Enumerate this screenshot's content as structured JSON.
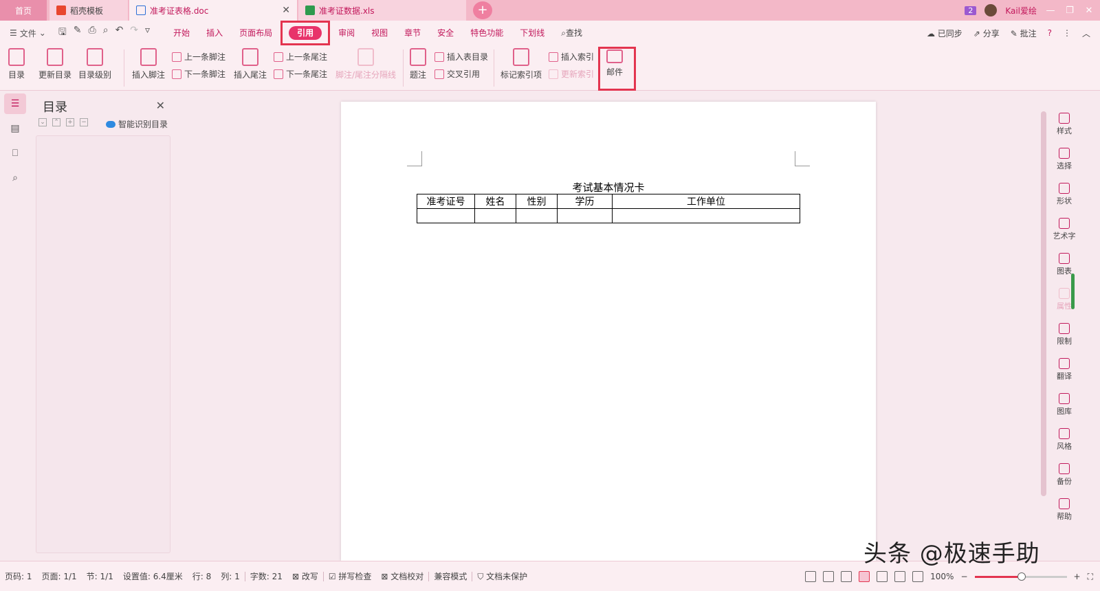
{
  "tabs": {
    "home": "首页",
    "template": "稻壳模板",
    "doc": "准考证表格.doc",
    "xls": "准考证数据.xls",
    "badge": "2",
    "user": "Kail爱绘"
  },
  "menu": {
    "file": "文件",
    "tabs": [
      "开始",
      "插入",
      "页面布局",
      "引用",
      "审阅",
      "视图",
      "章节",
      "安全",
      "特色功能",
      "下划线"
    ],
    "active_tab": "引用",
    "search": "查找",
    "sync": "已同步",
    "share": "分享",
    "comment": "批注"
  },
  "ribbon": {
    "toc": "目录",
    "update_toc": "更新目录",
    "toc_level": "目录级别",
    "insert_footnote": "插入脚注",
    "prev_footnote": "上一条脚注",
    "next_footnote": "下一条脚注",
    "insert_endnote": "插入尾注",
    "prev_endnote": "上一条尾注",
    "next_endnote": "下一条尾注",
    "footnote_sep": "脚注/尾注分隔线",
    "caption": "题注",
    "insert_table_toc": "插入表目录",
    "cross_ref": "交叉引用",
    "mark_index": "标记索引项",
    "insert_index": "插入索引",
    "update_index": "更新索引",
    "mail": "邮件"
  },
  "toc_panel": {
    "title": "目录",
    "smart": "智能识别目录"
  },
  "document": {
    "title": "考试基本情况卡",
    "headers": [
      "准考证号",
      "姓名",
      "性别",
      "学历",
      "工作单位"
    ]
  },
  "right_sidebar": [
    "样式",
    "选择",
    "形状",
    "艺术字",
    "图表",
    "属性",
    "限制",
    "翻译",
    "图库",
    "风格",
    "备份",
    "帮助"
  ],
  "status": {
    "page_num": "页码: 1",
    "pages": "页面: 1/1",
    "section": "节: 1/1",
    "setting": "设置值: 6.4厘米",
    "row": "行: 8",
    "col": "列: 1",
    "words": "字数: 21",
    "revise": "改写",
    "spell": "拼写检查",
    "proof": "文档校对",
    "compat": "兼容模式",
    "protect": "文档未保护",
    "zoom": "100%"
  },
  "watermark": "头条 @极速手助"
}
